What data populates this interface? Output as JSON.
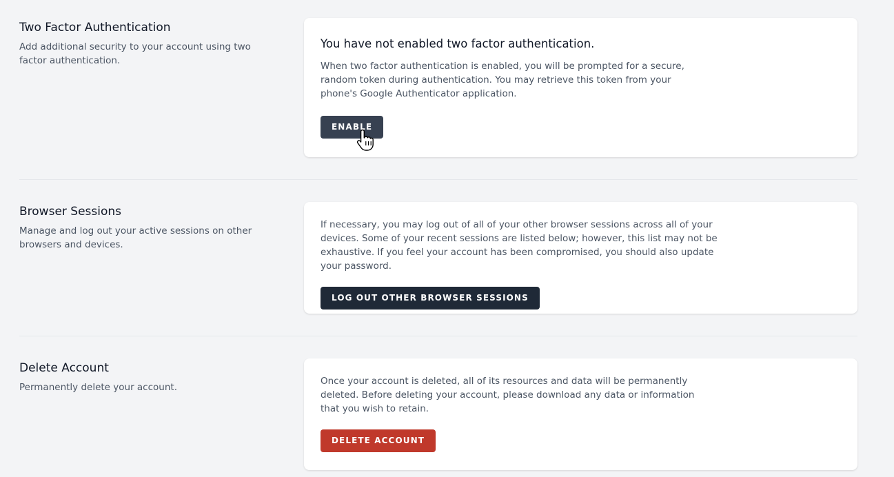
{
  "two_factor": {
    "title": "Two Factor Authentication",
    "description": "Add additional security to your account using two factor authentication.",
    "heading": "You have not enabled two factor authentication.",
    "body": "When two factor authentication is enabled, you will be prompted for a secure, random token during authentication. You may retrieve this token from your phone's Google Authenticator application.",
    "button_label": "Enable"
  },
  "browser_sessions": {
    "title": "Browser Sessions",
    "description": "Manage and log out your active sessions on other browsers and devices.",
    "body": "If necessary, you may log out of all of your other browser sessions across all of your devices. Some of your recent sessions are listed below; however, this list may not be exhaustive. If you feel your account has been compromised, you should also update your password.",
    "button_label": "Log Out Other Browser Sessions"
  },
  "delete_account": {
    "title": "Delete Account",
    "description": "Permanently delete your account.",
    "body": "Once your account is deleted, all of its resources and data will be permanently deleted. Before deleting your account, please download any data or information that you wish to retain.",
    "button_label": "Delete Account"
  },
  "colors": {
    "background": "#f3f4f6",
    "card": "#ffffff",
    "dark_button": "#1f2937",
    "danger_button": "#c0392b"
  },
  "icons": {
    "cursor": "hand-pointer-icon"
  }
}
